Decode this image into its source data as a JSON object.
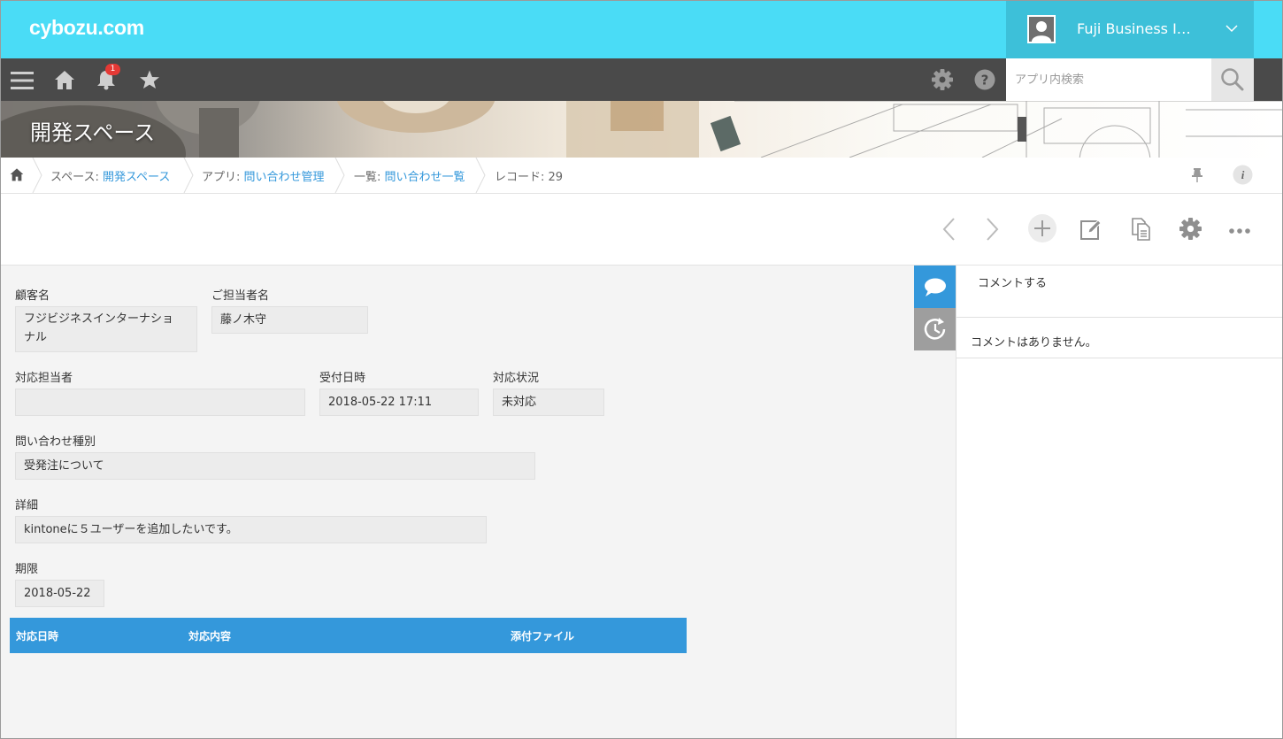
{
  "app": {
    "logo": "cybozu.com"
  },
  "user": {
    "name": "Fuji Business I…"
  },
  "nav": {
    "notification_count": "1",
    "search_placeholder": "アプリ内検索"
  },
  "banner": {
    "title": "開発スペース"
  },
  "breadcrumb": {
    "space_prefix": "スペース: ",
    "space": "開発スペース",
    "app_prefix": "アプリ: ",
    "app": "問い合わせ管理",
    "view_prefix": "一覧: ",
    "view": "問い合わせ一覧",
    "record": "レコード: 29"
  },
  "fields": {
    "customer_label": "顧客名",
    "customer_value_line1": "フジビジネスインターナショ",
    "customer_value_line2": "ナル",
    "contact_label": "ご担当者名",
    "contact_value": "藤ノ木守",
    "assignee_label": "対応担当者",
    "assignee_value": "",
    "received_label": "受付日時",
    "received_value": "2018-05-22 17:11",
    "status_label": "対応状況",
    "status_value": "未対応",
    "type_label": "問い合わせ種別",
    "type_value": "受発注について",
    "detail_label": "詳細",
    "detail_value": "kintoneに５ユーザーを追加したいです。",
    "deadline_label": "期限",
    "deadline_value": "2018-05-22"
  },
  "table": {
    "columns": [
      "対応日時",
      "対応内容",
      "添付ファイル"
    ]
  },
  "comments": {
    "post_label": "コメントする",
    "empty_text": "コメントはありません。"
  },
  "colors": {
    "topbar": "#4adcf6",
    "user_area": "#3dc0d9",
    "navbar": "#4a4a4a",
    "accent_blue": "#3498db"
  },
  "icons": {
    "nav": [
      "menu-icon",
      "home-icon",
      "bell-icon",
      "star-icon",
      "gear-icon",
      "help-icon",
      "search-icon"
    ],
    "toolbar": [
      "prev-icon",
      "next-icon",
      "add-icon",
      "edit-icon",
      "copy-icon",
      "settings-icon",
      "more-icon"
    ],
    "side": [
      "comment-icon",
      "history-icon"
    ]
  }
}
